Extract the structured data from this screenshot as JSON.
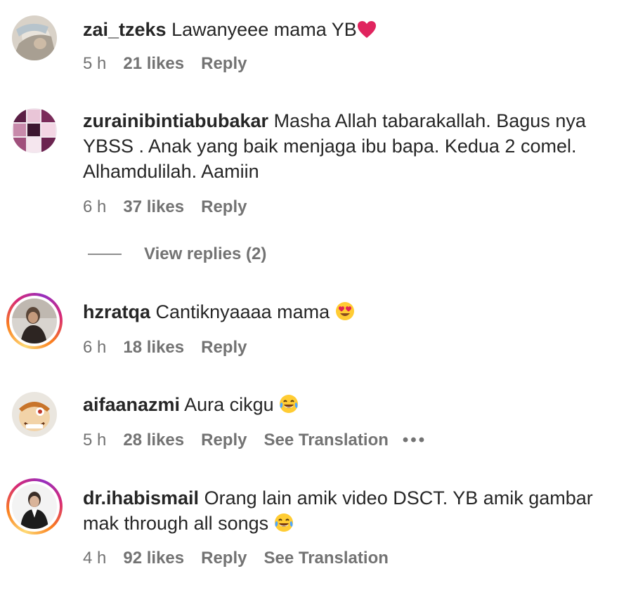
{
  "comments": [
    {
      "username": "zai_tzeks",
      "text": "Lawanyeee mama YB",
      "emoji": "heart-icon",
      "time": "5 h",
      "likes": "21 likes",
      "reply": "Reply"
    },
    {
      "username": "zurainibintiabubakar",
      "text": "Masha Allah tabarakallah. Bagus nya YBSS . Anak yang baik menjaga ibu bapa. Kedua 2 comel. Alhamdulilah. Aamiin",
      "time": "6 h",
      "likes": "37 likes",
      "reply": "Reply",
      "view_replies": "View replies (2)"
    },
    {
      "username": "hzratqa",
      "text": "Cantiknyaaaa mama",
      "emoji": "heart-eyes-emoji",
      "time": "6 h",
      "likes": "18 likes",
      "reply": "Reply"
    },
    {
      "username": "aifaanazmi",
      "text": "Aura cikgu",
      "emoji": "tears-of-joy-emoji",
      "time": "5 h",
      "likes": "28 likes",
      "reply": "Reply",
      "translation": "See Translation",
      "more": "•••"
    },
    {
      "username": "dr.ihabismail",
      "text": "Orang lain amik video DSCT. YB amik gambar mak through all songs",
      "emoji": "tears-of-joy-emoji",
      "time": "4 h",
      "likes": "92 likes",
      "reply": "Reply",
      "translation": "See Translation"
    }
  ],
  "colors": {
    "text": "#262626",
    "meta": "#737373",
    "ring_start": "#feda75",
    "ring_end": "#962fbf",
    "heart": "#e0245e"
  }
}
